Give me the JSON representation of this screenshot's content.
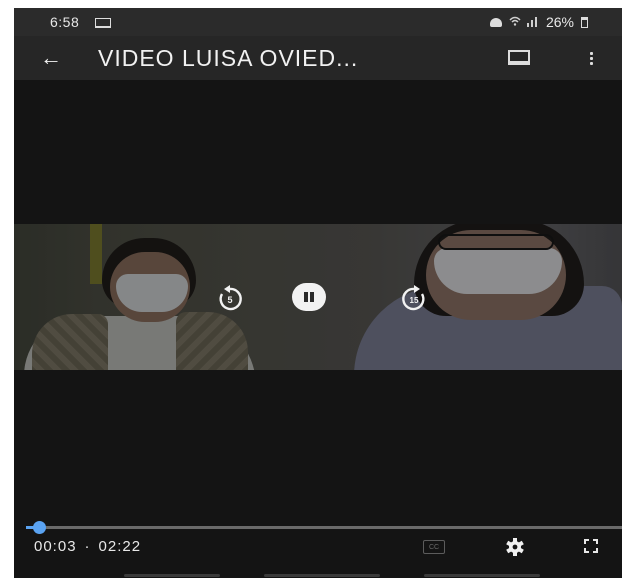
{
  "status_bar": {
    "time": "6:58",
    "battery": "26%",
    "icons": [
      "screen-cast-icon",
      "alarm-icon",
      "wifi-signal-icon",
      "battery-icon"
    ]
  },
  "app_bar": {
    "title": "VIDEO LUISA OVIED...",
    "icons": [
      "back-arrow-icon",
      "cast-icon",
      "more-vert-icon"
    ]
  },
  "player": {
    "rewind_seconds": "5",
    "forward_seconds": "15",
    "controls": [
      "rewind-icon",
      "pause-icon",
      "forward-icon"
    ]
  },
  "playback": {
    "current_time": "00:03",
    "separator": "·",
    "duration": "02:22",
    "progress_fraction": 0.021
  },
  "bottom_controls": {
    "cc_label": "CC",
    "icons": [
      "closed-captions-icon",
      "settings-gear-icon",
      "fullscreen-icon"
    ]
  },
  "colors": {
    "accent": "#5aa3f2",
    "background": "#141414",
    "app_bar": "#262626"
  }
}
